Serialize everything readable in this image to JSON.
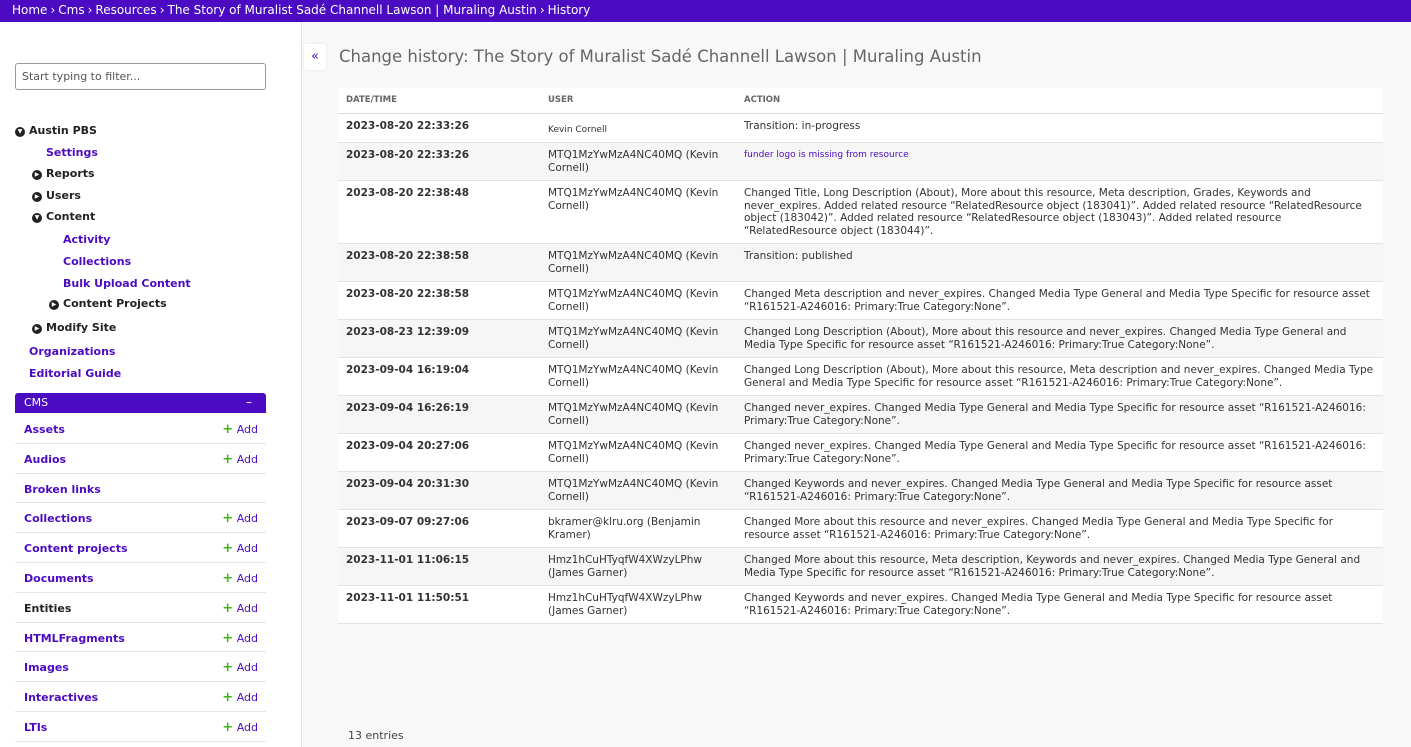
{
  "breadcrumb": [
    {
      "label": "Home"
    },
    {
      "label": "Cms"
    },
    {
      "label": "Resources"
    },
    {
      "label": "The Story of Muralist Sadé Channell Lawson | Muraling Austin"
    },
    {
      "label": "History"
    }
  ],
  "breadcrumb_separator": "›",
  "sidebar": {
    "filter_placeholder": "Start typing to filter...",
    "tree": {
      "austin_pbs": "Austin PBS",
      "settings": "Settings",
      "reports": "Reports",
      "users": "Users",
      "content": "Content",
      "activity": "Activity",
      "collections": "Collections",
      "bulk_upload": "Bulk Upload Content",
      "content_projects": "Content Projects",
      "modify_site": "Modify Site",
      "organizations": "Organizations",
      "editorial_guide": "Editorial Guide"
    },
    "cms": {
      "header": "CMS",
      "collapse": "–",
      "add_label": "Add",
      "items": [
        {
          "name": "Assets",
          "add": true
        },
        {
          "name": "Audios",
          "add": true
        },
        {
          "name": "Broken links",
          "add": false
        },
        {
          "name": "Collections",
          "add": true
        },
        {
          "name": "Content projects",
          "add": true
        },
        {
          "name": "Documents",
          "add": true
        },
        {
          "name": "Entities",
          "add": true
        },
        {
          "name": "HTMLFragments",
          "add": true
        },
        {
          "name": "Images",
          "add": true
        },
        {
          "name": "Interactives",
          "add": true
        },
        {
          "name": "LTIs",
          "add": true
        }
      ]
    }
  },
  "collapse_button": "«",
  "page_title": "Change history: The Story of Muralist Sadé Channell Lawson | Muraling Austin",
  "table": {
    "headers": {
      "datetime": "DATE/TIME",
      "user": "USER",
      "action": "ACTION"
    },
    "rows": [
      {
        "datetime": "2023-08-20 22:33:26",
        "user": "Kevin Cornell",
        "action": "Transition: in-progress"
      },
      {
        "datetime": "2023-08-20 22:33:26",
        "user": "MTQ1MzYwMzA4NC40MQ (Kevin Cornell)",
        "action": "funder logo is missing from resource"
      },
      {
        "datetime": "2023-08-20 22:38:48",
        "user": "MTQ1MzYwMzA4NC40MQ (Kevin Cornell)",
        "action": "Changed Title, Long Description (About), More about this resource, Meta description, Grades, Keywords and never_expires. Added related resource “RelatedResource object (183041)”. Added related resource “RelatedResource object (183042)”. Added related resource “RelatedResource object (183043)”. Added related resource “RelatedResource object (183044)”."
      },
      {
        "datetime": "2023-08-20 22:38:58",
        "user": "MTQ1MzYwMzA4NC40MQ (Kevin Cornell)",
        "action": "Transition: published"
      },
      {
        "datetime": "2023-08-20 22:38:58",
        "user": "MTQ1MzYwMzA4NC40MQ (Kevin Cornell)",
        "action": "Changed Meta description and never_expires. Changed Media Type General and Media Type Specific for resource asset “R161521-A246016: Primary:True Category:None”."
      },
      {
        "datetime": "2023-08-23 12:39:09",
        "user": "MTQ1MzYwMzA4NC40MQ (Kevin Cornell)",
        "action": "Changed Long Description (About), More about this resource and never_expires. Changed Media Type General and Media Type Specific for resource asset “R161521-A246016: Primary:True Category:None”."
      },
      {
        "datetime": "2023-09-04 16:19:04",
        "user": "MTQ1MzYwMzA4NC40MQ (Kevin Cornell)",
        "action": "Changed Long Description (About), More about this resource, Meta description and never_expires. Changed Media Type General and Media Type Specific for resource asset “R161521-A246016: Primary:True Category:None”."
      },
      {
        "datetime": "2023-09-04 16:26:19",
        "user": "MTQ1MzYwMzA4NC40MQ (Kevin Cornell)",
        "action": "Changed never_expires. Changed Media Type General and Media Type Specific for resource asset “R161521-A246016: Primary:True Category:None”."
      },
      {
        "datetime": "2023-09-04 20:27:06",
        "user": "MTQ1MzYwMzA4NC40MQ (Kevin Cornell)",
        "action": "Changed never_expires. Changed Media Type General and Media Type Specific for resource asset “R161521-A246016: Primary:True Category:None”."
      },
      {
        "datetime": "2023-09-04 20:31:30",
        "user": "MTQ1MzYwMzA4NC40MQ (Kevin Cornell)",
        "action": "Changed Keywords and never_expires. Changed Media Type General and Media Type Specific for resource asset “R161521-A246016: Primary:True Category:None”."
      },
      {
        "datetime": "2023-09-07 09:27:06",
        "user": "bkramer@klru.org (Benjamin Kramer)",
        "action": "Changed More about this resource and never_expires. Changed Media Type General and Media Type Specific for resource asset “R161521-A246016: Primary:True Category:None”."
      },
      {
        "datetime": "2023-11-01 11:06:15",
        "user": "Hmz1hCuHTyqfW4XWzyLPhw (James Garner)",
        "action": "Changed More about this resource, Meta description, Keywords and never_expires. Changed Media Type General and Media Type Specific for resource asset “R161521-A246016: Primary:True Category:None”."
      },
      {
        "datetime": "2023-11-01 11:50:51",
        "user": "Hmz1hCuHTyqfW4XWzyLPhw (James Garner)",
        "action": "Changed Keywords and never_expires. Changed Media Type General and Media Type Specific for resource asset “R161521-A246016: Primary:True Category:None”."
      }
    ],
    "entries_label": "13 entries"
  },
  "colors": {
    "brand": "#4b0bc2",
    "add_plus": "#3fb618"
  }
}
